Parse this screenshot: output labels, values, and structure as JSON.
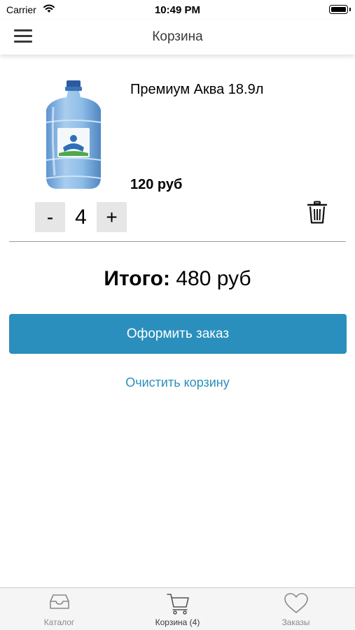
{
  "status_bar": {
    "carrier": "Carrier",
    "time": "10:49 PM"
  },
  "header": {
    "title": "Корзина",
    "menu_icon": "hamburger-menu-icon"
  },
  "cart": {
    "items": [
      {
        "name": "Премиум Аква 18.9л",
        "price": "120 руб",
        "quantity": "4",
        "minus_label": "-",
        "plus_label": "+",
        "image": "water-bottle-image",
        "delete_icon": "trash-icon"
      }
    ],
    "total_label": "Итого:",
    "total_value": "480 руб",
    "checkout_label": "Оформить заказ",
    "clear_label": "Очистить корзину"
  },
  "tabs": [
    {
      "label": "Каталог",
      "icon": "inbox-icon",
      "active": false
    },
    {
      "label": "Корзина (4)",
      "icon": "cart-icon",
      "active": true
    },
    {
      "label": "Заказы",
      "icon": "heart-icon",
      "active": false
    }
  ],
  "colors": {
    "accent": "#2a8fbd",
    "qty_button_bg": "#e6e6e6",
    "tab_bar_bg": "#f5f5f5"
  }
}
